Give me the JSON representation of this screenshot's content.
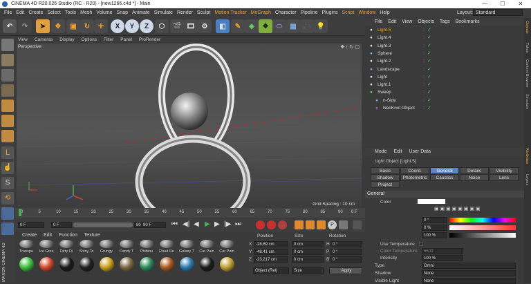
{
  "window": {
    "title": "CINEMA 4D R20.026 Studio (RC - R20) - [new1266.c4d *] - Main",
    "minimize": "—",
    "maximize": "☐",
    "close": "✕"
  },
  "menu": [
    "File",
    "Edit",
    "Create",
    "Select",
    "Tools",
    "Mesh",
    "Volume",
    "Snap",
    "Animate",
    "Simulate",
    "Render",
    "Sculpt",
    "Motion Tracker",
    "MoGraph",
    "Character",
    "Pipeline",
    "Plugins",
    "Script",
    "Window",
    "Help"
  ],
  "layout": {
    "label": "Layout:",
    "value": "Standard"
  },
  "toolbar": {
    "axis_x": "X",
    "axis_y": "Y",
    "axis_z": "Z"
  },
  "viewport": {
    "menu": [
      "View",
      "Cameras",
      "Display",
      "Options",
      "Filter",
      "Panel",
      "ProRender"
    ],
    "label": "Perspective",
    "grid_spacing": "Grid Spacing : 10 cm"
  },
  "timeline": {
    "ticks": [
      "0",
      "5",
      "10",
      "15",
      "20",
      "25",
      "30",
      "35",
      "40",
      "45",
      "50",
      "55",
      "60",
      "65",
      "70",
      "75",
      "80",
      "85",
      "90"
    ],
    "end": "0 F"
  },
  "transport": {
    "current": "0 F",
    "start": "0 F",
    "max": "90 F",
    "end": "90 F"
  },
  "materials": {
    "menu": [
      "Create",
      "Edit",
      "Function",
      "Texture"
    ],
    "row1": [
      "Transpa",
      "Ice Gree",
      "Dirty Oi",
      "Shiny Te",
      "Grungy",
      "Candy T",
      "Phibiou",
      "Road Re",
      "Galaxy T",
      "Car Pain",
      "Car Pain"
    ],
    "row2_colors": [
      "#3cbf3c",
      "#d24a2a",
      "#1a1a1a",
      "#202020",
      "#c8a018",
      "#7a6a40",
      "#2a8a5a",
      "#aa5a20",
      "#2a7ab0",
      "#1a1a1a",
      "#c0a030"
    ]
  },
  "coords": {
    "headers": [
      "Position",
      "Size",
      "Rotation"
    ],
    "rows": [
      {
        "axis": "X",
        "pos": "-28.69 cm",
        "size": "0 cm",
        "rlabel": "H",
        "rot": "0 °"
      },
      {
        "axis": "Y",
        "pos": "-48.41 cm",
        "size": "0 cm",
        "rlabel": "P",
        "rot": "0 °"
      },
      {
        "axis": "Z",
        "pos": "-23.217 cm",
        "size": "0 cm",
        "rlabel": "B",
        "rot": "0 °"
      }
    ],
    "mode": "Object (Rel)",
    "size_mode": "Size",
    "apply": "Apply"
  },
  "objects": {
    "menu": [
      "File",
      "Edit",
      "View",
      "Objects",
      "Tags",
      "Bookmarks"
    ],
    "items": [
      {
        "name": "Light.5",
        "indent": 0,
        "selected": true,
        "icon": "light"
      },
      {
        "name": "Light.4",
        "indent": 0,
        "selected": false,
        "icon": "light"
      },
      {
        "name": "Light.3",
        "indent": 0,
        "selected": false,
        "icon": "light"
      },
      {
        "name": "Sphere",
        "indent": 0,
        "selected": false,
        "icon": "sphere"
      },
      {
        "name": "Light.2",
        "indent": 0,
        "selected": false,
        "icon": "light"
      },
      {
        "name": "Landscape",
        "indent": 0,
        "selected": false,
        "icon": "landscape"
      },
      {
        "name": "Light",
        "indent": 0,
        "selected": false,
        "icon": "light"
      },
      {
        "name": "Light.1",
        "indent": 0,
        "selected": false,
        "icon": "light"
      },
      {
        "name": "Sweep",
        "indent": 0,
        "selected": false,
        "icon": "sweep"
      },
      {
        "name": "n-Side",
        "indent": 1,
        "selected": false,
        "icon": "nside"
      },
      {
        "name": "NeoKnot Object",
        "indent": 1,
        "selected": false,
        "icon": "spline"
      }
    ]
  },
  "attributes": {
    "menu": [
      "Mode",
      "Edit",
      "User Data"
    ],
    "object_label": "Light Object [Light.5]",
    "tabs_row1": [
      "Basic",
      "Coord.",
      "General",
      "Details",
      "Visibility"
    ],
    "tabs_row2": [
      "Shadow",
      "Photometric",
      "Caustics",
      "Noise",
      "Lens"
    ],
    "tabs_row3": [
      "Project"
    ],
    "active_tab": "General",
    "section": "General",
    "color_label": "Color",
    "h_value": "0 °",
    "s_value": "0 %",
    "v_value": "100 %",
    "use_temperature": "Use Temperature",
    "color_temperature": "Color Temperature",
    "color_temperature_value": "6500",
    "intensity": "Intensity",
    "intensity_value": "100 %",
    "type": "Type",
    "type_value": "Omni",
    "shadow": "Shadow",
    "shadow_value": "None",
    "visible_light": "Visible Light",
    "visible_light_value": "None"
  },
  "right_strip": [
    "Objects",
    "Takes",
    "Content Browser",
    "Structure",
    "Attributes",
    "Layers"
  ],
  "branding": {
    "line1": "MAXON",
    "line2": "CINEMA 4D"
  }
}
